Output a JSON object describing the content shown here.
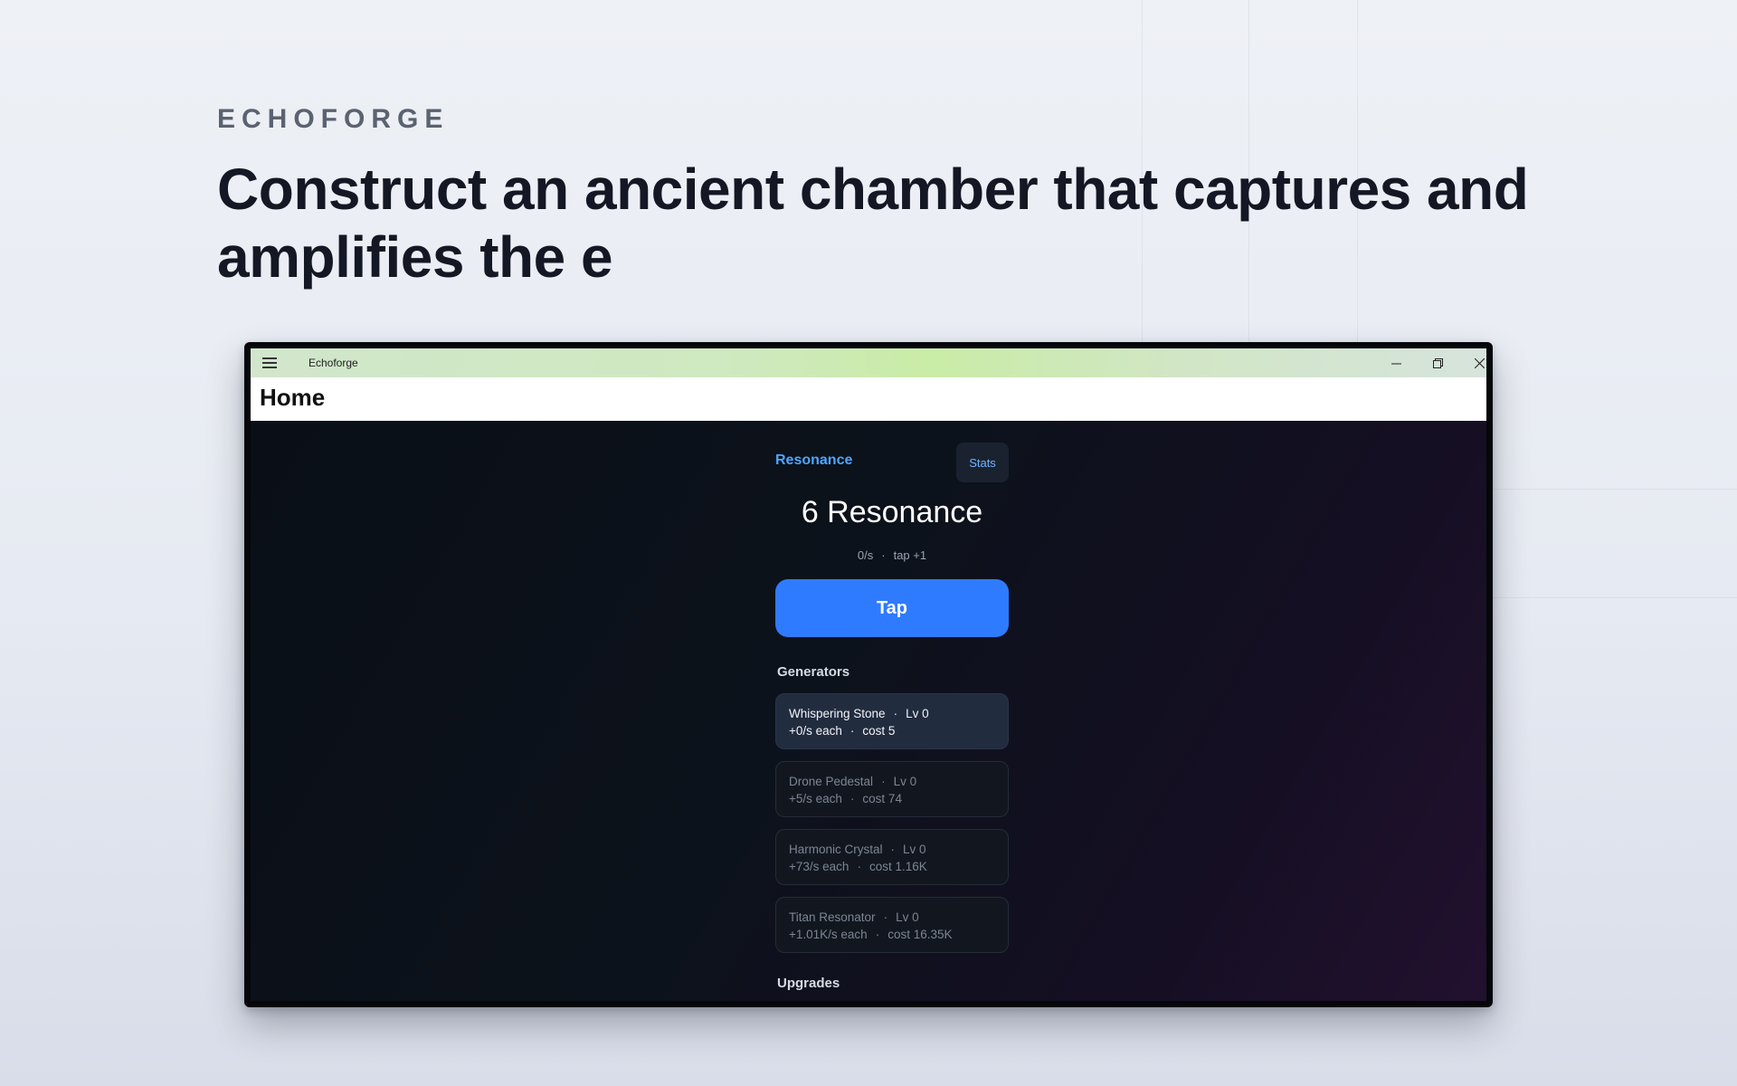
{
  "brand": "ECHOFORGE",
  "headline": "Construct an ancient chamber that captures and amplifies the e",
  "window": {
    "app_title": "Echoforge",
    "page_title": "Home"
  },
  "game": {
    "resource_label": "Resonance",
    "stats_label": "Stats",
    "resource_count": "6 Resonance",
    "rate": "0/s",
    "tap_value": "tap +1",
    "tap_label": "Tap",
    "generators_heading": "Generators",
    "generators": [
      {
        "name": "Whispering Stone",
        "level": "Lv 0",
        "rate": "+0/s each",
        "cost": "cost 5"
      },
      {
        "name": "Drone Pedestal",
        "level": "Lv 0",
        "rate": "+5/s each",
        "cost": "cost 74"
      },
      {
        "name": "Harmonic Crystal",
        "level": "Lv 0",
        "rate": "+73/s each",
        "cost": "cost 1.16K"
      },
      {
        "name": "Titan Resonator",
        "level": "Lv 0",
        "rate": "+1.01K/s each",
        "cost": "cost 16.35K"
      }
    ],
    "upgrades_heading": "Upgrades"
  },
  "colors": {
    "accent": "#2f7bff",
    "resource_label": "#4ea6ff"
  }
}
